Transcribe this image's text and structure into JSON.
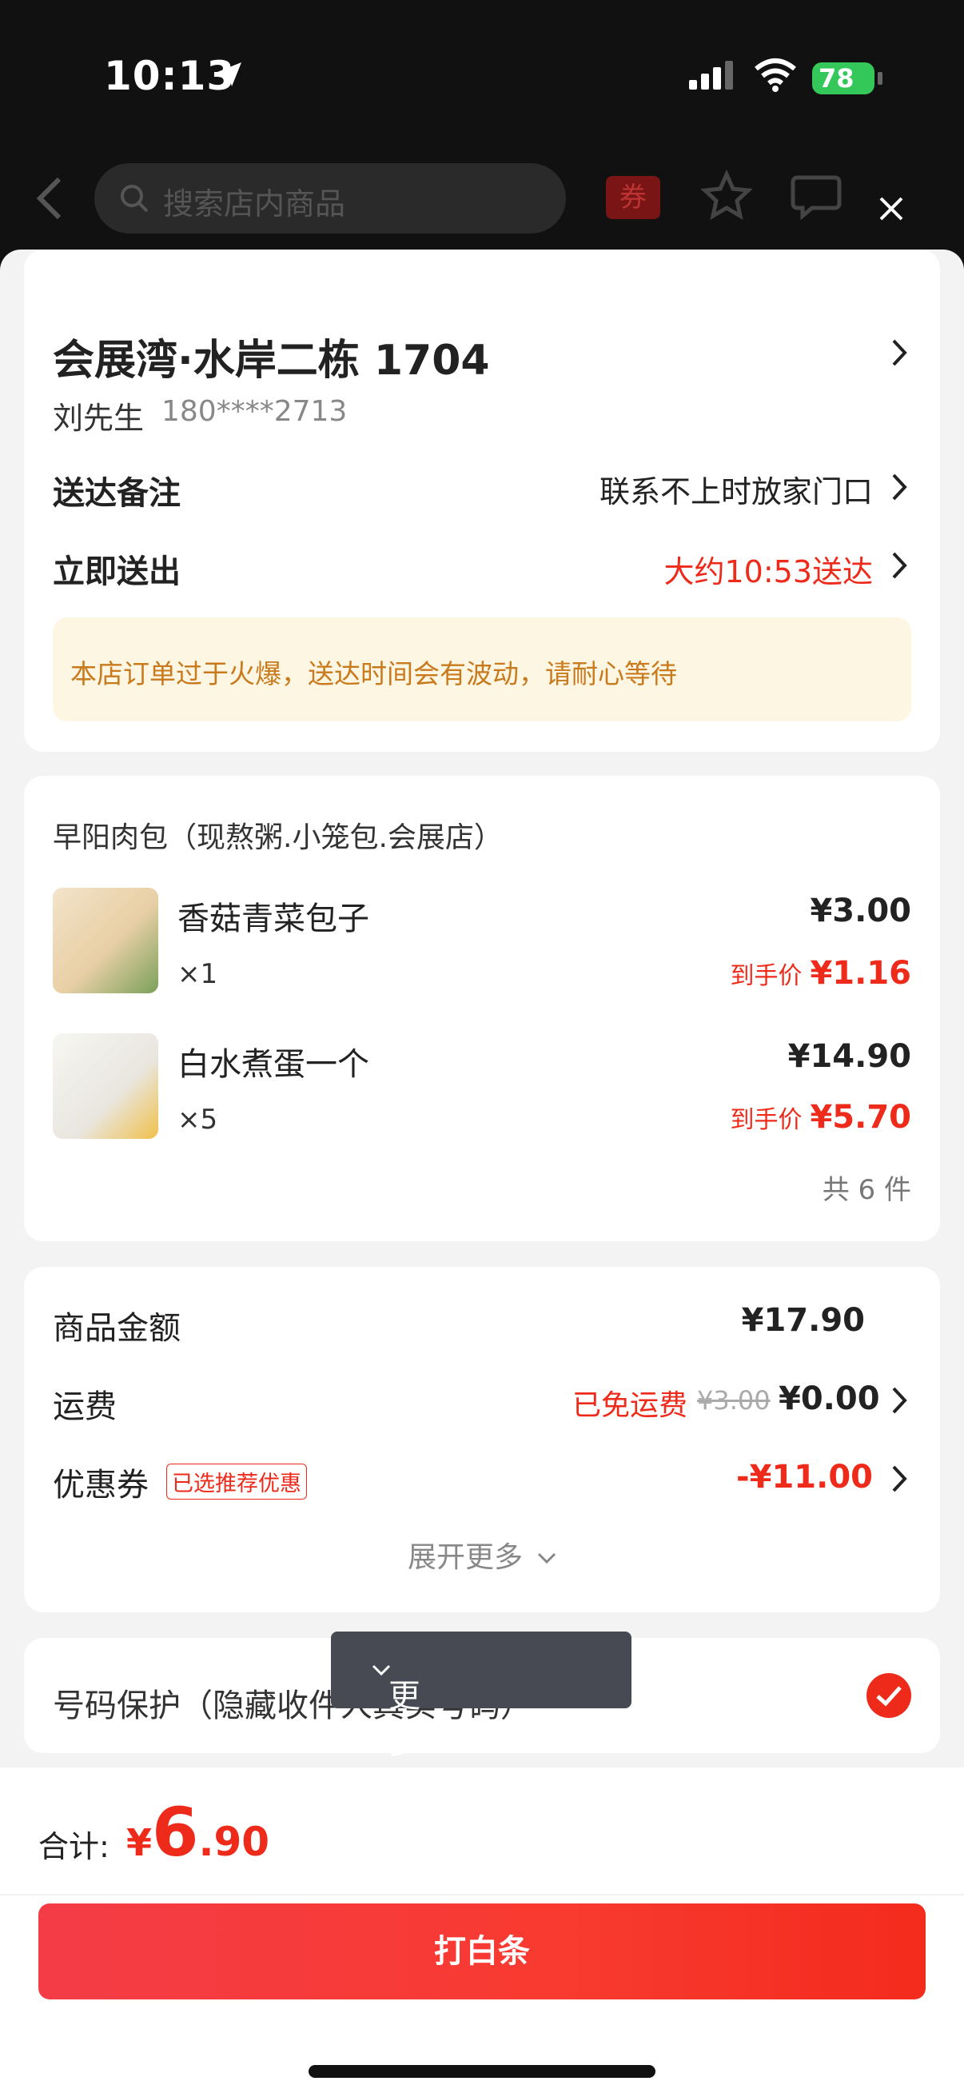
{
  "status_bar": {
    "time": "10:13",
    "battery": "78"
  },
  "nav": {
    "search_placeholder": "搜索店内商品",
    "coupon_label": "券"
  },
  "address": {
    "title": "会展湾·水岸二栋 1704",
    "name": "刘先生",
    "phone": "180****2713",
    "note_label": "送达备注",
    "note_value": "联系不上时放家门口",
    "delivery_label": "立即送出",
    "delivery_value": "大约10:53送达",
    "notice": "本店订单过于火爆，送达时间会有波动，请耐心等待"
  },
  "shop": {
    "name": "早阳肉包（现熬粥.小笼包.会展店）",
    "items": [
      {
        "name": "香菇青菜包子",
        "qty": "×1",
        "price": "¥3.00",
        "final_label": "到手价",
        "final_price": "¥1.16"
      },
      {
        "name": "白水煮蛋一个",
        "qty": "×5",
        "price": "¥14.90",
        "final_label": "到手价",
        "final_price": "¥5.70"
      }
    ],
    "total_count": "共 6 件"
  },
  "fees": {
    "goods_label": "商品金额",
    "goods_value": "¥17.90",
    "shipping_label": "运费",
    "shipping_free_tag": "已免运费",
    "shipping_original": "¥3.00",
    "shipping_value": "¥0.00",
    "coupon_label": "优惠券",
    "coupon_badge": "已选推荐优惠",
    "coupon_value": "-¥11.00",
    "expand_label": "展开更多"
  },
  "privacy": {
    "label": "号码保护（隐藏收件人真实号码）"
  },
  "tooltip": {
    "label": "更多支付方式"
  },
  "checkout": {
    "total_label": "合计:",
    "total_yen": "¥",
    "total_int": "6",
    "total_dec": ".90",
    "pay_button": "打白条"
  },
  "colors": {
    "accent_red": "#ee2a1a",
    "notice_bg": "#fdf6e3",
    "notice_text": "#c87a1c"
  }
}
